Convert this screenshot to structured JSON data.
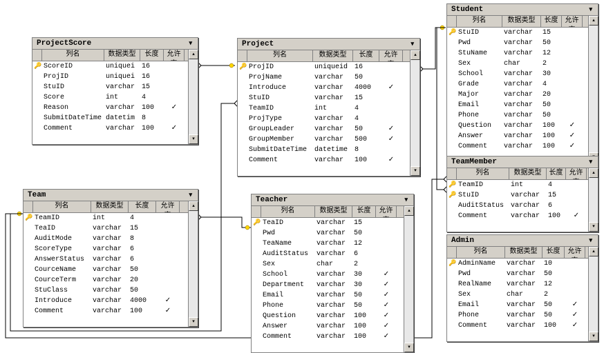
{
  "headers": {
    "col_name": "列名",
    "col_type": "数据类型",
    "col_len": "长度",
    "col_null": "允许空"
  },
  "tables": {
    "projectscore": {
      "title": "ProjectScore",
      "rows": [
        {
          "key": true,
          "name": "ScoreID",
          "type": "uniquei",
          "len": "16",
          "nullable": ""
        },
        {
          "key": false,
          "name": "ProjID",
          "type": "uniquei",
          "len": "16",
          "nullable": ""
        },
        {
          "key": false,
          "name": "StuID",
          "type": "varchar",
          "len": "15",
          "nullable": ""
        },
        {
          "key": false,
          "name": "Score",
          "type": "int",
          "len": "4",
          "nullable": ""
        },
        {
          "key": false,
          "name": "Reason",
          "type": "varchar",
          "len": "100",
          "nullable": "✓"
        },
        {
          "key": false,
          "name": "SubmitDateTime",
          "type": "datetim",
          "len": "8",
          "nullable": ""
        },
        {
          "key": false,
          "name": "Comment",
          "type": "varchar",
          "len": "100",
          "nullable": "✓"
        }
      ]
    },
    "project": {
      "title": "Project",
      "rows": [
        {
          "key": true,
          "name": "ProjID",
          "type": "uniqueid",
          "len": "16",
          "nullable": ""
        },
        {
          "key": false,
          "name": "ProjName",
          "type": "varchar",
          "len": "50",
          "nullable": ""
        },
        {
          "key": false,
          "name": "Introduce",
          "type": "varchar",
          "len": "4000",
          "nullable": "✓"
        },
        {
          "key": false,
          "name": "StuID",
          "type": "varchar",
          "len": "15",
          "nullable": ""
        },
        {
          "key": false,
          "name": "TeamID",
          "type": "int",
          "len": "4",
          "nullable": ""
        },
        {
          "key": false,
          "name": "ProjType",
          "type": "varchar",
          "len": "4",
          "nullable": ""
        },
        {
          "key": false,
          "name": "GroupLeader",
          "type": "varchar",
          "len": "50",
          "nullable": "✓"
        },
        {
          "key": false,
          "name": "GroupMember",
          "type": "varchar",
          "len": "500",
          "nullable": "✓"
        },
        {
          "key": false,
          "name": "SubmitDateTime",
          "type": "datetime",
          "len": "8",
          "nullable": ""
        },
        {
          "key": false,
          "name": "Comment",
          "type": "varchar",
          "len": "100",
          "nullable": "✓"
        }
      ]
    },
    "student": {
      "title": "Student",
      "rows": [
        {
          "key": true,
          "name": "StuID",
          "type": "varchar",
          "len": "15",
          "nullable": ""
        },
        {
          "key": false,
          "name": "Pwd",
          "type": "varchar",
          "len": "50",
          "nullable": ""
        },
        {
          "key": false,
          "name": "StuName",
          "type": "varchar",
          "len": "12",
          "nullable": ""
        },
        {
          "key": false,
          "name": "Sex",
          "type": "char",
          "len": "2",
          "nullable": ""
        },
        {
          "key": false,
          "name": "School",
          "type": "varchar",
          "len": "30",
          "nullable": ""
        },
        {
          "key": false,
          "name": "Grade",
          "type": "varchar",
          "len": "4",
          "nullable": ""
        },
        {
          "key": false,
          "name": "Major",
          "type": "varchar",
          "len": "20",
          "nullable": ""
        },
        {
          "key": false,
          "name": "Email",
          "type": "varchar",
          "len": "50",
          "nullable": ""
        },
        {
          "key": false,
          "name": "Phone",
          "type": "varchar",
          "len": "50",
          "nullable": ""
        },
        {
          "key": false,
          "name": "Question",
          "type": "varchar",
          "len": "100",
          "nullable": "✓"
        },
        {
          "key": false,
          "name": "Answer",
          "type": "varchar",
          "len": "100",
          "nullable": "✓"
        },
        {
          "key": false,
          "name": "Comment",
          "type": "varchar",
          "len": "100",
          "nullable": "✓"
        }
      ]
    },
    "team": {
      "title": "Team",
      "rows": [
        {
          "key": true,
          "name": "TeamID",
          "type": "int",
          "len": "4",
          "nullable": ""
        },
        {
          "key": false,
          "name": "TeaID",
          "type": "varchar",
          "len": "15",
          "nullable": ""
        },
        {
          "key": false,
          "name": "AuditMode",
          "type": "varchar",
          "len": "8",
          "nullable": ""
        },
        {
          "key": false,
          "name": "ScoreType",
          "type": "varchar",
          "len": "6",
          "nullable": ""
        },
        {
          "key": false,
          "name": "AnswerStatus",
          "type": "varchar",
          "len": "6",
          "nullable": ""
        },
        {
          "key": false,
          "name": "CourceName",
          "type": "varchar",
          "len": "50",
          "nullable": ""
        },
        {
          "key": false,
          "name": "CourceTerm",
          "type": "varchar",
          "len": "20",
          "nullable": ""
        },
        {
          "key": false,
          "name": "StuClass",
          "type": "varchar",
          "len": "50",
          "nullable": ""
        },
        {
          "key": false,
          "name": "Introduce",
          "type": "varchar",
          "len": "4000",
          "nullable": "✓"
        },
        {
          "key": false,
          "name": "Comment",
          "type": "varchar",
          "len": "100",
          "nullable": "✓"
        }
      ]
    },
    "teacher": {
      "title": "Teacher",
      "rows": [
        {
          "key": true,
          "name": "TeaID",
          "type": "varchar",
          "len": "15",
          "nullable": ""
        },
        {
          "key": false,
          "name": "Pwd",
          "type": "varchar",
          "len": "50",
          "nullable": ""
        },
        {
          "key": false,
          "name": "TeaName",
          "type": "varchar",
          "len": "12",
          "nullable": ""
        },
        {
          "key": false,
          "name": "AuditStatus",
          "type": "varchar",
          "len": "6",
          "nullable": ""
        },
        {
          "key": false,
          "name": "Sex",
          "type": "char",
          "len": "2",
          "nullable": ""
        },
        {
          "key": false,
          "name": "School",
          "type": "varchar",
          "len": "30",
          "nullable": "✓"
        },
        {
          "key": false,
          "name": "Department",
          "type": "varchar",
          "len": "30",
          "nullable": "✓"
        },
        {
          "key": false,
          "name": "Email",
          "type": "varchar",
          "len": "50",
          "nullable": "✓"
        },
        {
          "key": false,
          "name": "Phone",
          "type": "varchar",
          "len": "50",
          "nullable": "✓"
        },
        {
          "key": false,
          "name": "Question",
          "type": "varchar",
          "len": "100",
          "nullable": "✓"
        },
        {
          "key": false,
          "name": "Answer",
          "type": "varchar",
          "len": "100",
          "nullable": "✓"
        },
        {
          "key": false,
          "name": "Comment",
          "type": "varchar",
          "len": "100",
          "nullable": "✓"
        }
      ]
    },
    "teammember": {
      "title": "TeamMember",
      "rows": [
        {
          "key": true,
          "name": "TeamID",
          "type": "int",
          "len": "4",
          "nullable": ""
        },
        {
          "key": true,
          "name": "StuID",
          "type": "varchar",
          "len": "15",
          "nullable": ""
        },
        {
          "key": false,
          "name": "AuditStatus",
          "type": "varchar",
          "len": "6",
          "nullable": ""
        },
        {
          "key": false,
          "name": "Comment",
          "type": "varchar",
          "len": "100",
          "nullable": "✓"
        }
      ]
    },
    "admin": {
      "title": "Admin",
      "rows": [
        {
          "key": true,
          "name": "AdminName",
          "type": "varchar",
          "len": "10",
          "nullable": ""
        },
        {
          "key": false,
          "name": "Pwd",
          "type": "varchar",
          "len": "50",
          "nullable": ""
        },
        {
          "key": false,
          "name": "RealName",
          "type": "varchar",
          "len": "12",
          "nullable": ""
        },
        {
          "key": false,
          "name": "Sex",
          "type": "char",
          "len": "2",
          "nullable": ""
        },
        {
          "key": false,
          "name": "Email",
          "type": "varchar",
          "len": "50",
          "nullable": "✓"
        },
        {
          "key": false,
          "name": "Phone",
          "type": "varchar",
          "len": "50",
          "nullable": "✓"
        },
        {
          "key": false,
          "name": "Comment",
          "type": "varchar",
          "len": "100",
          "nullable": "✓"
        }
      ]
    }
  }
}
